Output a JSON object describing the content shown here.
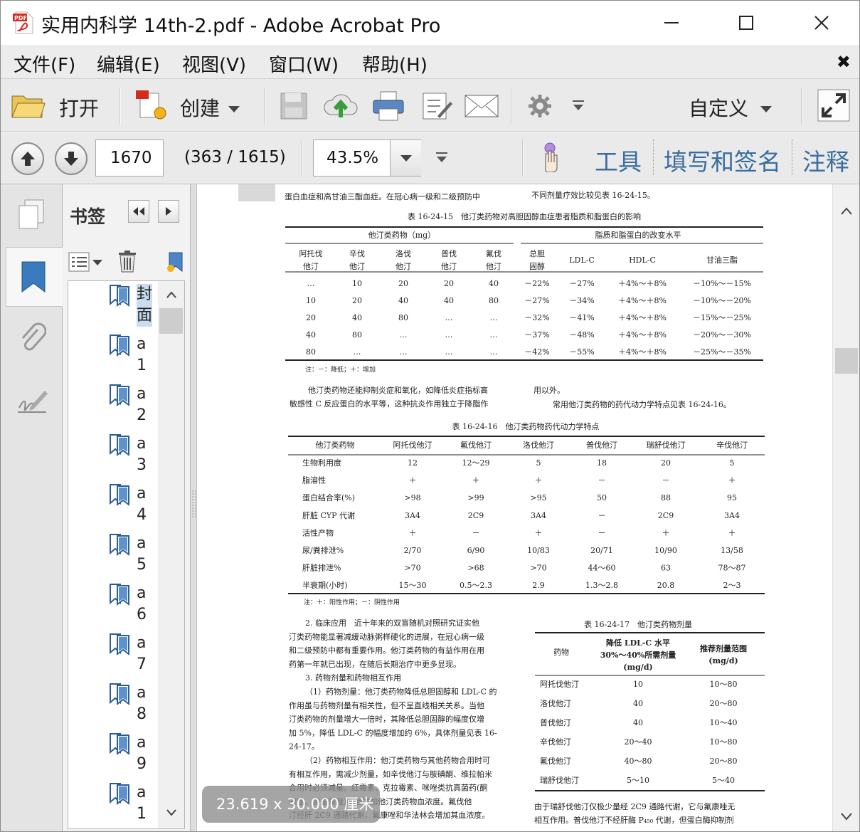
{
  "window": {
    "title": "实用内科学 14th-2.pdf - Adobe Acrobat Pro",
    "minimize": "—",
    "maximize": "☐",
    "close": "✕"
  },
  "menu": {
    "items": [
      "文件(F)",
      "编辑(E)",
      "视图(V)",
      "窗口(W)",
      "帮助(H)"
    ],
    "close": "✖"
  },
  "toolbar": {
    "open_label": "打开",
    "create_label": "创建",
    "customize_label": "自定义"
  },
  "nav": {
    "page_number": "1670",
    "page_count": "(363 / 1615)",
    "zoom": "43.5%",
    "tools": "工具",
    "fill_sign": "填写和签名",
    "comment": "注释"
  },
  "bookmarks": {
    "title": "书签",
    "items": [
      {
        "label": "封面"
      },
      {
        "label": "a1"
      },
      {
        "label": "a2"
      },
      {
        "label": "a3"
      },
      {
        "label": "a4"
      },
      {
        "label": "a5"
      },
      {
        "label": "a6"
      },
      {
        "label": "a7"
      },
      {
        "label": "a8"
      },
      {
        "label": "a9"
      },
      {
        "label": "a1"
      }
    ]
  },
  "document": {
    "top_line1": "蛋白血症和高甘油三酯血症。在冠心病一级和二级预防中",
    "top_line1_right": "不同剂量疗效比较见表 16-24-15。",
    "table1": {
      "title": "表 16-24-15　他汀类药物对高胆固醇血症患者脂质和脂蛋白的影响",
      "group_left": "他汀类药物（mg）",
      "group_right": "脂质和脂蛋白的改变水平",
      "headers": [
        "阿托伐\n他汀",
        "辛伐\n他汀",
        "洛伐\n他汀",
        "普伐\n他汀",
        "氟伐\n他汀",
        "总胆\n固醇",
        "LDL-C",
        "HDL-C",
        "甘油三酯"
      ],
      "rows": [
        [
          "…",
          "10",
          "20",
          "20",
          "40",
          "－22%",
          "－27%",
          "＋4%～＋8%",
          "－10%～－15%"
        ],
        [
          "10",
          "20",
          "40",
          "40",
          "80",
          "－27%",
          "－34%",
          "＋4%～＋8%",
          "－10%～－20%"
        ],
        [
          "20",
          "40",
          "80",
          "…",
          "…",
          "－32%",
          "－41%",
          "＋4%～＋8%",
          "－15%～－25%"
        ],
        [
          "40",
          "80",
          "…",
          "…",
          "…",
          "－37%",
          "－48%",
          "＋4%～＋8%",
          "－20%～－30%"
        ],
        [
          "80",
          "…",
          "…",
          "…",
          "…",
          "－42%",
          "－55%",
          "＋4%～＋8%",
          "－25%～－35%"
        ]
      ],
      "note": "注：－：降低；＋：增加"
    },
    "mid_para_l1": "他汀类药物还能抑制炎症和氧化，如降低炎症指标高",
    "mid_para_l2": "敏感性 C 反应蛋白的水平等，这种抗炎作用独立于降脂作",
    "mid_para_r1": "用以外。",
    "mid_para_r2": "常用他汀类药物的药代动力学特点见表 16-24-16。",
    "table2": {
      "title": "表 16-24-16　他汀类药物药代动力学特点",
      "headers": [
        "他汀类药物",
        "阿托伐他汀",
        "氟伐他汀",
        "洛伐他汀",
        "普伐他汀",
        "瑞舒伐他汀",
        "辛伐他汀"
      ],
      "rows": [
        [
          "生物利用度",
          "12",
          "12～29",
          "5",
          "18",
          "20",
          "5"
        ],
        [
          "脂溶性",
          "＋",
          "＋",
          "＋",
          "－",
          "－",
          "＋"
        ],
        [
          "蛋白结合率(%)",
          ">98",
          ">99",
          ">95",
          "50",
          "88",
          "95"
        ],
        [
          "肝脏 CYP 代谢",
          "3A4",
          "2C9",
          "3A4",
          "－",
          "2C9",
          "3A4"
        ],
        [
          "活性产物",
          "＋",
          "－",
          "＋",
          "－",
          "＋",
          "＋"
        ],
        [
          "尿/粪排泄%",
          "2/70",
          "6/90",
          "10/83",
          "20/71",
          "10/90",
          "13/58"
        ],
        [
          "肝脏排泄%",
          ">70",
          ">68",
          ">70",
          "44～60",
          "63",
          "78～87"
        ],
        [
          "半衰期(小时)",
          "15～30",
          "0.5～2.3",
          "2.9",
          "1.3～2.8",
          "20.8",
          "2～3"
        ]
      ],
      "note": "注：＋：阳性作用；－：阴性作用"
    },
    "left_col": [
      "2. 临床应用　近十年来的双盲随机对照研究证实他",
      "汀类药物能显著减缓动脉粥样硬化的进展，在冠心病一级",
      "和二级预防中都有重要作用。他汀类药物的有益作用在用",
      "药第一年就已出现，在随后长期治疗中更多显现。",
      "3. 药物剂量和药物相互作用",
      "（1）药物剂量：他汀类药物降低总胆固醇和 LDL-C 的",
      "作用虽与药物剂量有相关性，但不呈直线相关关系。当他",
      "汀类药物的剂量增大一倍时，其降低总胆固醇的幅度仅增",
      "加 5%，降低 LDL-C 的幅度增加约 6%，具体剂量见表 16-",
      "24-17。",
      "（2）药物相互作用：他汀类药物与其他药物合用时可",
      "有相互作用，需减少剂量，如辛伐他汀与胺碘酮、维拉帕米",
      "合用时必须减量。红霉素、克拉霉素、咪唑类抗真菌药(酮",
      "康唑、伊曲康唑)都会增加他汀类药物血浓度。氟伐他",
      "汀经肝 2C9 通路代谢，氟康唑和华法林会增加其血浓度。"
    ],
    "table3": {
      "title": "表 16-24-17　他汀类药物剂量",
      "headers": [
        "药物",
        "降低 LDL-C 水平\n30%～40%所需剂量\n(mg/d)",
        "推荐剂量范围\n(mg/d)"
      ],
      "rows": [
        [
          "阿托伐他汀",
          "10",
          "10～80"
        ],
        [
          "洛伐他汀",
          "40",
          "20～80"
        ],
        [
          "普伐他汀",
          "40",
          "10～40"
        ],
        [
          "辛伐他汀",
          "20～40",
          "10～80"
        ],
        [
          "氟伐他汀",
          "40～80",
          "20～80"
        ],
        [
          "瑞舒伐他汀",
          "5～10",
          "5～40"
        ]
      ]
    },
    "right_bottom_l1": "由于瑞舒伐他汀仅极少量经 2C9 通路代谢，它与氟康唑无",
    "right_bottom_l2": "相互作用。普伐他汀不经肝酶 P₄₅₀ 代谢，但蛋白酶抑制剂"
  },
  "size_tooltip": "23.619 x 30.000 厘米"
}
